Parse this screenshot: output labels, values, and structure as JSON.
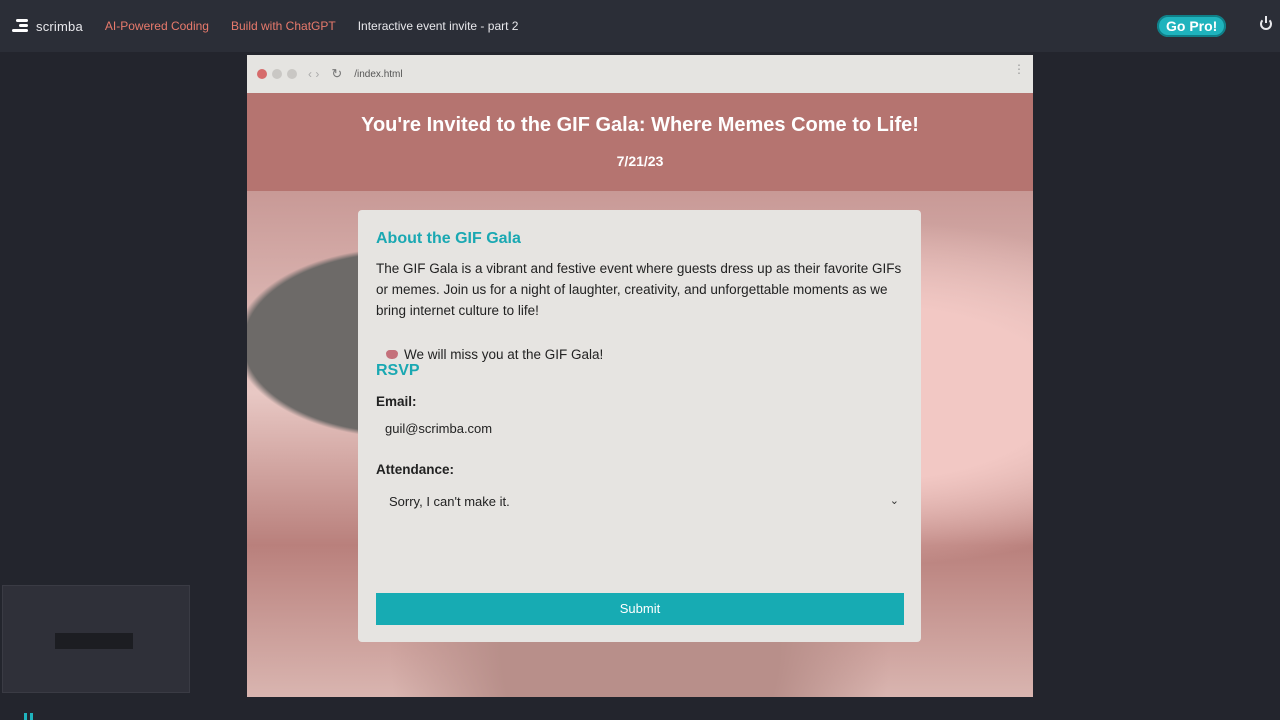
{
  "nav": {
    "logo_text": "scrimba",
    "breadcrumbs": [
      "AI-Powered Coding",
      "Build with ChatGPT",
      "Interactive event invite - part 2"
    ],
    "gopro_label": "Go Pro!",
    "colors": {
      "accent": "#1fb3bd",
      "link": "#e87a6c"
    }
  },
  "browser": {
    "url": "/index.html",
    "hero": {
      "title": "You're Invited to the GIF Gala: Where Memes Come to Life!",
      "date": "7/21/23",
      "color": "#b57470"
    },
    "card": {
      "about_heading": "About the GIF Gala",
      "about_text": "The GIF Gala is a vibrant and festive event where guests dress up as their favorite GIFs or memes. Join us for a night of laughter, creativity, and unforgettable moments as we bring internet culture to life!",
      "status_message": "We will miss you at the GIF Gala!",
      "rsvp_heading": "RSVP",
      "email_label": "Email:",
      "email_value": "guil@scrimba.com",
      "attendance_label": "Attendance:",
      "attendance_value": "Sorry, I can't make it.",
      "submit_label": "Submit",
      "accent_color": "#17abb3"
    }
  },
  "icons": [
    "scrimba-logo-icon",
    "power-icon",
    "reload-icon",
    "heart-icon",
    "chevron-down-icon",
    "pause-icon"
  ]
}
